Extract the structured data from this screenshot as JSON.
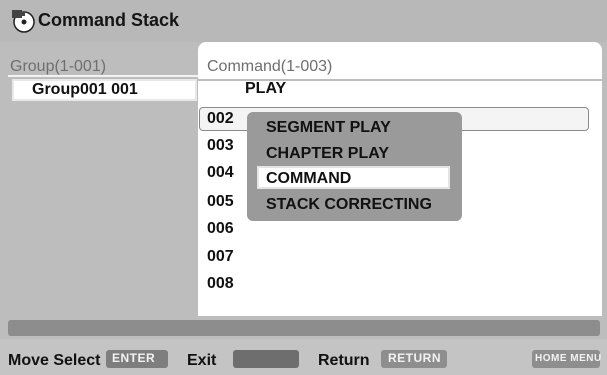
{
  "header": {
    "title": "Command Stack",
    "icon": "disc-camera-icon"
  },
  "group_panel": {
    "header": "Group(1-001)",
    "items": [
      {
        "label": "Group001 001"
      }
    ]
  },
  "command_panel": {
    "header": "Command(1-003)",
    "first_action": "PLAY",
    "rows": [
      "002",
      "003",
      "004",
      "005",
      "006",
      "007",
      "008"
    ]
  },
  "context_menu": {
    "items": [
      "SEGMENT PLAY",
      "CHAPTER PLAY",
      "COMMAND",
      "STACK CORRECTING"
    ],
    "selected": "COMMAND"
  },
  "footer": {
    "move_select_label": "Move Select",
    "move_select_key": "ENTER",
    "exit_label": "Exit",
    "return_label": "Return",
    "return_key": "RETURN",
    "home_menu_key": "HOME MENU"
  }
}
